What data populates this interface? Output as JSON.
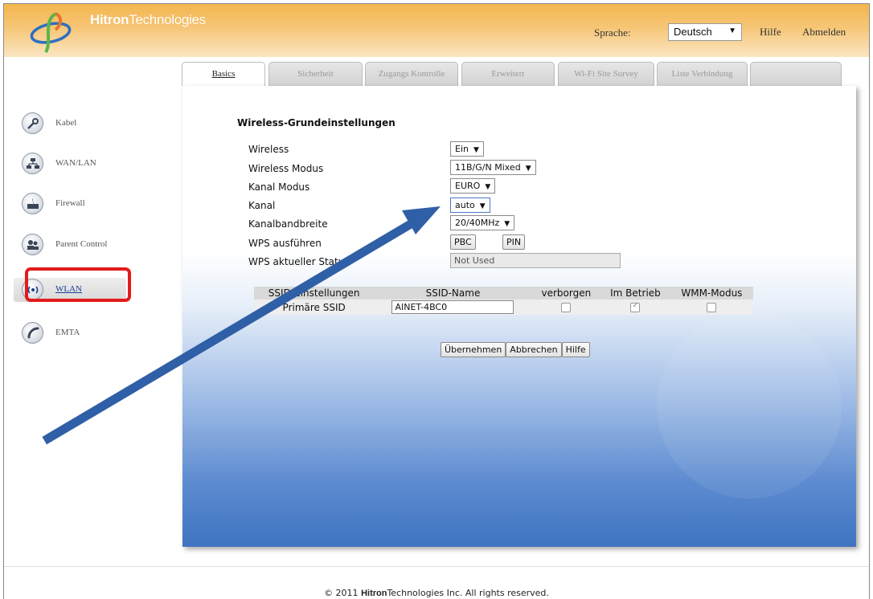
{
  "header": {
    "brand_bold": "Hitron",
    "brand_thin": "Technologies",
    "language_label": "Sprache:",
    "language_value": "Deutsch",
    "help_link": "Hilfe",
    "logout_link": "Abmelden"
  },
  "tabs": [
    {
      "label": "Basics",
      "active": true
    },
    {
      "label": "Sicherheit"
    },
    {
      "label": "Zugangs Kontrolle"
    },
    {
      "label": "Erweitert"
    },
    {
      "label": "Wi-Fi Site Survey"
    },
    {
      "label": "Liste Verbindung"
    },
    {
      "label": ""
    }
  ],
  "sidebar": {
    "items": [
      {
        "label": "Kabel",
        "icon": "wrench-icon"
      },
      {
        "label": "WAN/LAN",
        "icon": "network-icon"
      },
      {
        "label": "Firewall",
        "icon": "firewall-icon"
      },
      {
        "label": "Parent Control",
        "icon": "users-icon"
      },
      {
        "label": "WLAN",
        "icon": "wifi-icon",
        "active": true
      },
      {
        "label": "EMTA",
        "icon": "phone-icon"
      }
    ]
  },
  "form": {
    "title": "Wireless-Grundeinstellungen",
    "wireless_label": "Wireless",
    "wireless_value": "Ein",
    "mode_label": "Wireless Modus",
    "mode_value": "11B/G/N Mixed",
    "channel_mode_label": "Kanal Modus",
    "channel_mode_value": "EURO",
    "channel_label": "Kanal",
    "channel_value": "auto",
    "bandwidth_label": "Kanalbandbreite",
    "bandwidth_value": "20/40MHz",
    "wps_run_label": "WPS ausführen",
    "wps_pbc": "PBC",
    "wps_pin": "PIN",
    "wps_status_label": "WPS aktueller Status",
    "wps_status_value": "Not Used"
  },
  "ssid_table": {
    "headers": [
      "SSID-Einstellungen",
      "SSID-Name",
      "verborgen",
      "Im Betrieb",
      "WMM-Modus"
    ],
    "rows": [
      {
        "setting": "Primäre SSID",
        "name": "AINET-4BC0",
        "hidden": false,
        "active": true,
        "wmm": false
      }
    ]
  },
  "actions": {
    "apply": "Übernehmen",
    "cancel": "Abbrechen",
    "help": "Hilfe"
  },
  "footer": {
    "prefix": "© 2011",
    "brand_bold": "Hitron",
    "brand_thin": "Technologies",
    "suffix": "Inc.  All rights reserved."
  },
  "colors": {
    "header_orange": "#f4b64e",
    "panel_blue": "#3f74c2",
    "highlight_red": "#e21b1b",
    "arrow_blue": "#2f5fa6"
  }
}
